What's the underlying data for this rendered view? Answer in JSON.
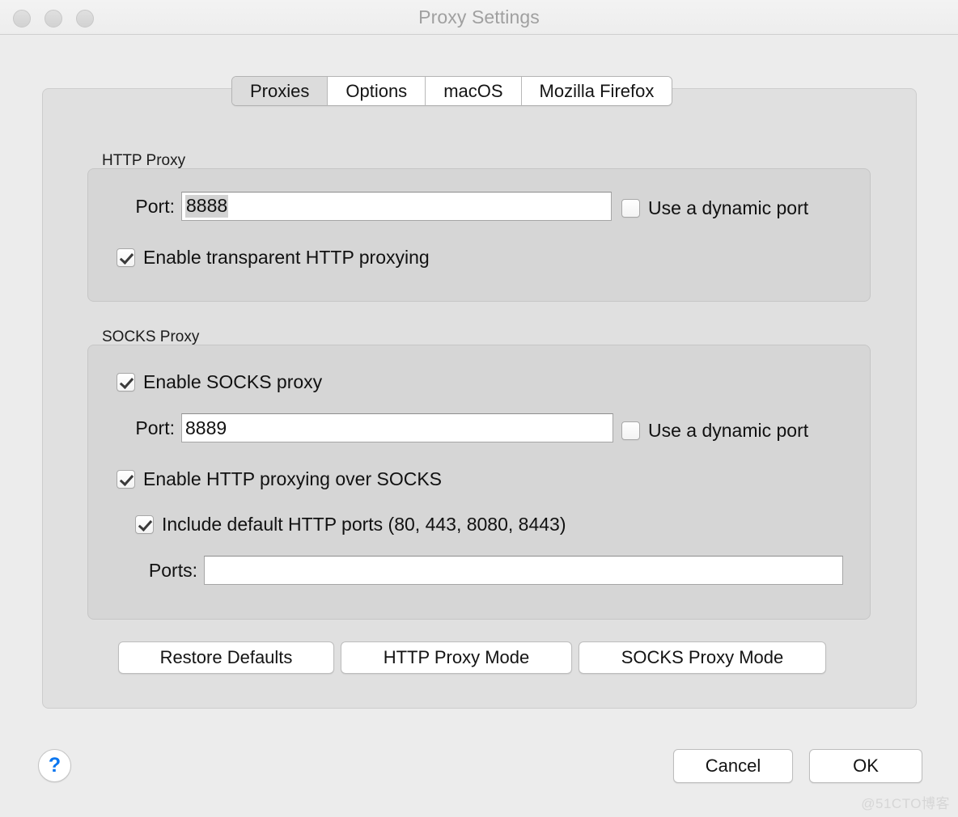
{
  "window": {
    "title": "Proxy Settings",
    "traffic_lights": [
      "close",
      "minimize",
      "zoom"
    ]
  },
  "tabs": [
    {
      "label": "Proxies",
      "selected": true
    },
    {
      "label": "Options",
      "selected": false
    },
    {
      "label": "macOS",
      "selected": false
    },
    {
      "label": "Mozilla Firefox",
      "selected": false
    }
  ],
  "http_proxy": {
    "group_title": "HTTP Proxy",
    "port_label": "Port:",
    "port_value": "8888",
    "port_value_selected": true,
    "dynamic_port_label": "Use a dynamic port",
    "dynamic_port_checked": false,
    "transparent_label": "Enable transparent HTTP proxying",
    "transparent_checked": true
  },
  "socks_proxy": {
    "group_title": "SOCKS Proxy",
    "enable_label": "Enable SOCKS proxy",
    "enable_checked": true,
    "port_label": "Port:",
    "port_value": "8889",
    "dynamic_port_label": "Use a dynamic port",
    "dynamic_port_checked": false,
    "http_over_socks_label": "Enable HTTP proxying over SOCKS",
    "http_over_socks_checked": true,
    "include_defaults_label": "Include default HTTP ports (80, 443, 8080, 8443)",
    "include_defaults_checked": true,
    "ports_label": "Ports:",
    "ports_value": "",
    "ports_placeholder": ""
  },
  "mode_buttons": {
    "restore_defaults": "Restore Defaults",
    "http_proxy_mode": "HTTP Proxy Mode",
    "socks_proxy_mode": "SOCKS Proxy Mode"
  },
  "bottom_bar": {
    "help": "?",
    "cancel": "Cancel",
    "ok": "OK"
  },
  "watermark": "@51CTO博客",
  "colors": {
    "window_background": "#ececec",
    "titlebar_text": "#a0a0a0",
    "panel_background": "#e0e0e0",
    "group_background": "#d6d6d6",
    "selected_tab_background": "#dcdcdc",
    "text": "#111111",
    "help_blue": "#0a76f0",
    "selection_highlight": "#d2d2d2"
  }
}
